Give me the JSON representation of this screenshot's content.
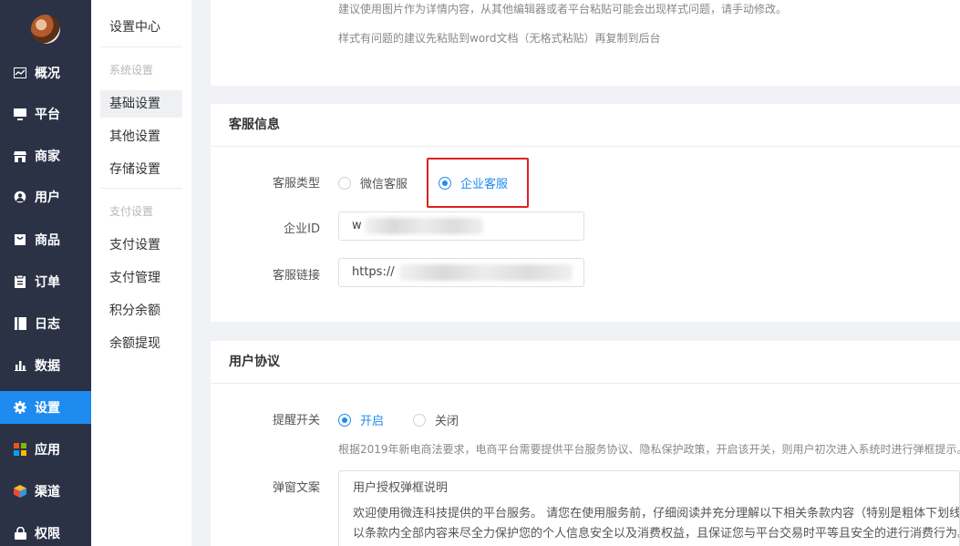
{
  "nav": {
    "items": [
      {
        "label": "概况",
        "icon": "dashboard-icon"
      },
      {
        "label": "平台",
        "icon": "monitor-icon"
      },
      {
        "label": "商家",
        "icon": "store-icon"
      },
      {
        "label": "用户",
        "icon": "user-icon"
      },
      {
        "label": "商品",
        "icon": "product-icon"
      },
      {
        "label": "订单",
        "icon": "order-icon"
      },
      {
        "label": "日志",
        "icon": "log-icon"
      },
      {
        "label": "数据",
        "icon": "bar-chart-icon"
      },
      {
        "label": "设置",
        "icon": "gear-icon",
        "active": true
      },
      {
        "label": "应用",
        "icon": "apps-icon"
      },
      {
        "label": "渠道",
        "icon": "cube-icon"
      },
      {
        "label": "权限",
        "icon": "lock-icon"
      }
    ],
    "active_color": "#1e8bf0"
  },
  "subnav": {
    "title": "设置中心",
    "groups": [
      {
        "title": "系统设置",
        "items": [
          "基础设置",
          "其他设置",
          "存储设置"
        ]
      },
      {
        "title": "支付设置",
        "items": [
          "支付设置",
          "支付管理",
          "积分余额",
          "余额提现"
        ]
      }
    ],
    "active": "基础设置"
  },
  "detail_hints": {
    "line1": "建议使用图片作为详情内容，从其他编辑器或者平台粘贴可能会出现样式问题，请手动修改。",
    "line2": "样式有问题的建议先粘贴到word文档（无格式粘贴）再复制到后台"
  },
  "service": {
    "title": "客服信息",
    "type_label": "客服类型",
    "options": [
      "微信客服",
      "企业客服"
    ],
    "selected": "企业客服",
    "corp_id_label": "企业ID",
    "corp_id_value": "w",
    "link_label": "客服链接",
    "link_value": "https://"
  },
  "agreement": {
    "title": "用户协议",
    "remind_label": "提醒开关",
    "options": [
      "开启",
      "关闭"
    ],
    "selected": "开启",
    "remind_hint": "根据2019年新电商法要求，电商平台需要提供平台服务协议、隐私保护政策，开启该开关，则用户初次进入系统时进行弹框提示。",
    "popup_label": "弹窗文案",
    "popup_lines": [
      "用户授权弹框说明",
      "欢迎使用微连科技提供的平台服务。 请您在使用服务前，仔细阅读并充分理解以下相关条款内容（特别是粗体下划线",
      "以条款内全部内容来尽全力保护您的个人信息安全以及消费权益，且保证您与平台交易时平等且安全的进行消费行为。"
    ]
  }
}
